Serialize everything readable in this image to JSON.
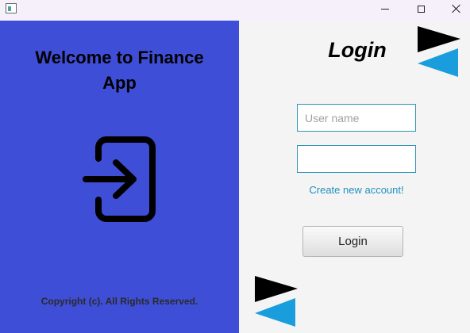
{
  "window": {
    "controls": {
      "minimize_icon": "minimize-icon",
      "maximize_icon": "maximize-icon",
      "close_icon": "close-icon"
    }
  },
  "left_panel": {
    "welcome_line1": "Welcome to Finance",
    "welcome_line2": "App",
    "icon": "login-arrow-icon",
    "copyright": "Copyright (c). All Rights Reserved.",
    "background_color": "#3f4ed6"
  },
  "form": {
    "title": "Login",
    "username": {
      "value": "",
      "placeholder": "User name"
    },
    "password": {
      "value": "",
      "placeholder": ""
    },
    "create_account_link": "Create new account!",
    "login_button": "Login"
  },
  "colors": {
    "link": "#1e8fbf",
    "field_border": "#2f94b8",
    "deco_black": "#000000",
    "deco_blue": "#1a9ddc"
  }
}
